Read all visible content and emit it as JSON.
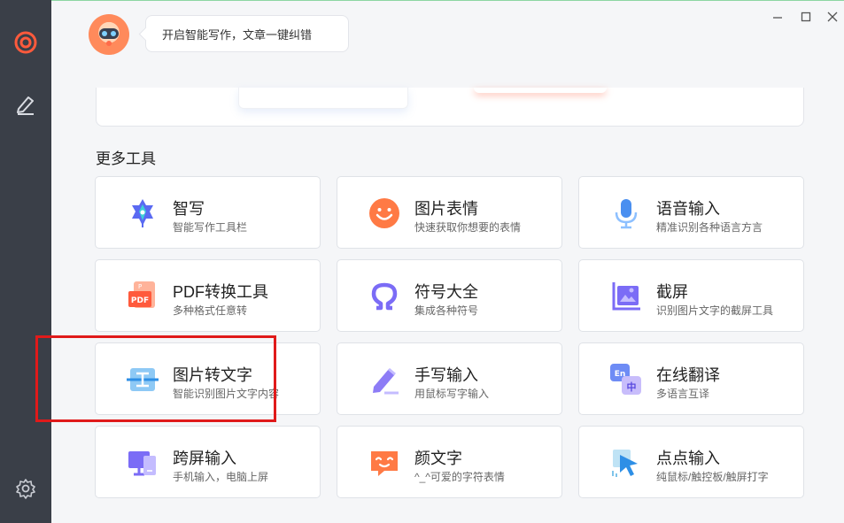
{
  "bubble_text": "开启智能写作，文章一键纠错",
  "section_title": "更多工具",
  "tools": [
    {
      "title": "智写",
      "sub": "智能写作工具栏",
      "icon": "ai-write-icon"
    },
    {
      "title": "图片表情",
      "sub": "快速获取你想要的表情",
      "icon": "smiley-icon"
    },
    {
      "title": "语音输入",
      "sub": "精准识别各种语言方言",
      "icon": "microphone-icon"
    },
    {
      "title": "PDF转换工具",
      "sub": "多种格式任意转",
      "icon": "pdf-icon"
    },
    {
      "title": "符号大全",
      "sub": "集成各种符号",
      "icon": "omega-icon"
    },
    {
      "title": "截屏",
      "sub": "识别图片文字的截屏工具",
      "icon": "screenshot-icon"
    },
    {
      "title": "图片转文字",
      "sub": "智能识别图片文字内容",
      "icon": "ocr-icon"
    },
    {
      "title": "手写输入",
      "sub": "用鼠标写字输入",
      "icon": "pencil-icon"
    },
    {
      "title": "在线翻译",
      "sub": "多语言互译",
      "icon": "translate-icon",
      "badge_en": "En",
      "badge_zh": "中"
    },
    {
      "title": "跨屏输入",
      "sub": "手机输入，电脑上屏",
      "icon": "cross-screen-icon"
    },
    {
      "title": "颜文字",
      "sub": "^_^可爱的字符表情",
      "icon": "kaomoji-icon"
    },
    {
      "title": "点点输入",
      "sub": "纯鼠标/触控板/触屏打字",
      "icon": "cursor-click-icon"
    }
  ],
  "colors": {
    "sidebar": "#3a3f48",
    "accent": "#ff5a3c",
    "highlight": "#e01a1a",
    "blue": "#4a8ff0",
    "purple": "#7b6cf6",
    "orange": "#ff7a45"
  }
}
